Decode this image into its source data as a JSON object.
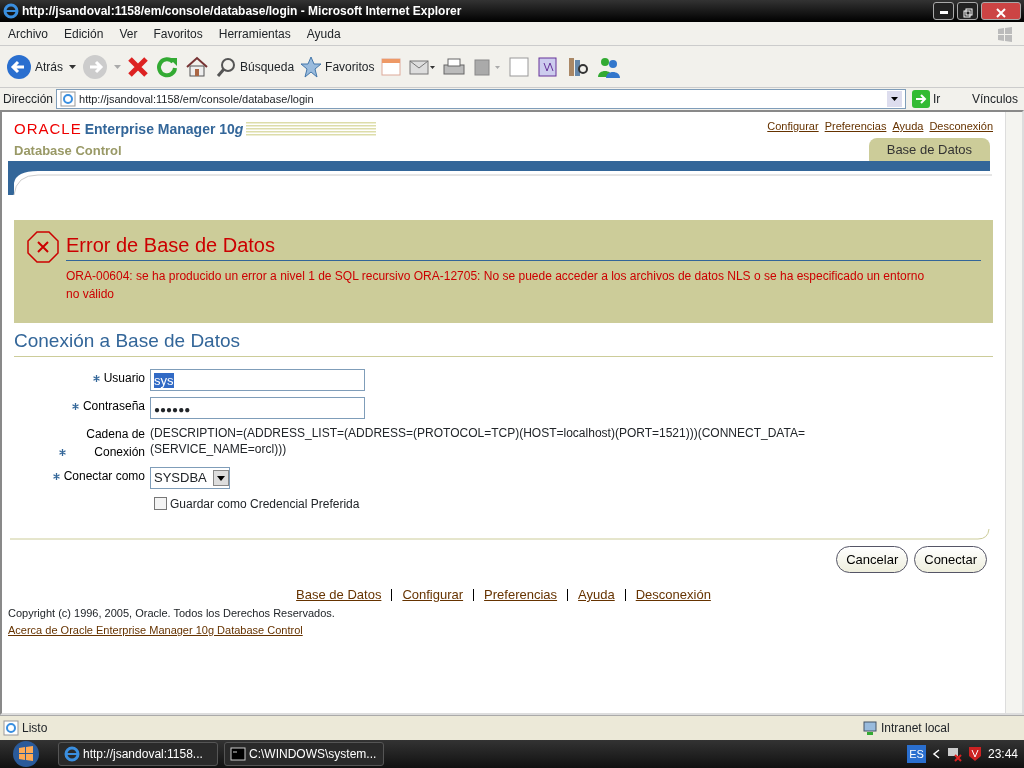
{
  "window": {
    "title": "http://jsandoval:1158/em/console/database/login - Microsoft Internet Explorer"
  },
  "menu": [
    "Archivo",
    "Edición",
    "Ver",
    "Favoritos",
    "Herramientas",
    "Ayuda"
  ],
  "toolbar": {
    "back_label": "Atrás",
    "search_label": "Búsqueda",
    "favorites_label": "Favoritos"
  },
  "address_bar": {
    "label": "Dirección",
    "url": "http://jsandoval:1158/em/console/database/login",
    "go_label": "Ir",
    "links_label": "Vínculos"
  },
  "page": {
    "logo": {
      "brand": "ORACLE",
      "product": "Enterprise Manager 10",
      "product_suffix": "g",
      "subtitle": "Database Control"
    },
    "global_links": [
      "Configurar",
      "Preferencias",
      "Ayuda",
      "Desconexión"
    ],
    "tabs": [
      {
        "label": "Base de Datos",
        "selected": true
      }
    ],
    "error": {
      "title": "Error de Base de Datos",
      "message": "ORA-00604: se ha producido un error a nivel 1 de SQL recursivo ORA-12705: No se puede acceder a los archivos de datos NLS o se ha especificado un entorno no válido"
    },
    "section_title": "Conexión a Base de Datos",
    "fields": [
      {
        "kind": "text",
        "label": "Usuario",
        "required": true,
        "value": "sys",
        "text_selected": true
      },
      {
        "kind": "password",
        "label": "Contraseña",
        "required": true,
        "value": "●●●●●●"
      },
      {
        "kind": "static",
        "label": "Cadena de Conexión",
        "required": true,
        "value": "(DESCRIPTION=(ADDRESS_LIST=(ADDRESS=(PROTOCOL=TCP)(HOST=localhost)(PORT=1521)))(CONNECT_DATA=(SERVICE_NAME=orcl)))"
      },
      {
        "kind": "select",
        "label": "Conectar como",
        "required": true,
        "value": "SYSDBA"
      },
      {
        "kind": "checkbox",
        "label": "Guardar como Credencial Preferida",
        "checked": false
      }
    ],
    "buttons": [
      "Cancelar",
      "Conectar"
    ],
    "footer_links": [
      "Base de Datos",
      "Configurar",
      "Preferencias",
      "Ayuda",
      "Desconexión"
    ],
    "copyright": "Copyright (c) 1996, 2005, Oracle. Todos los Derechos Reservados.",
    "about_link": "Acerca de Oracle Enterprise Manager 10g Database Control"
  },
  "status_bar": {
    "text": "Listo",
    "zone": "Intranet local"
  },
  "taskbar": {
    "items": [
      "http://jsandoval:1158...",
      "C:\\WINDOWS\\system..."
    ],
    "language": "ES",
    "clock": "23:44"
  }
}
